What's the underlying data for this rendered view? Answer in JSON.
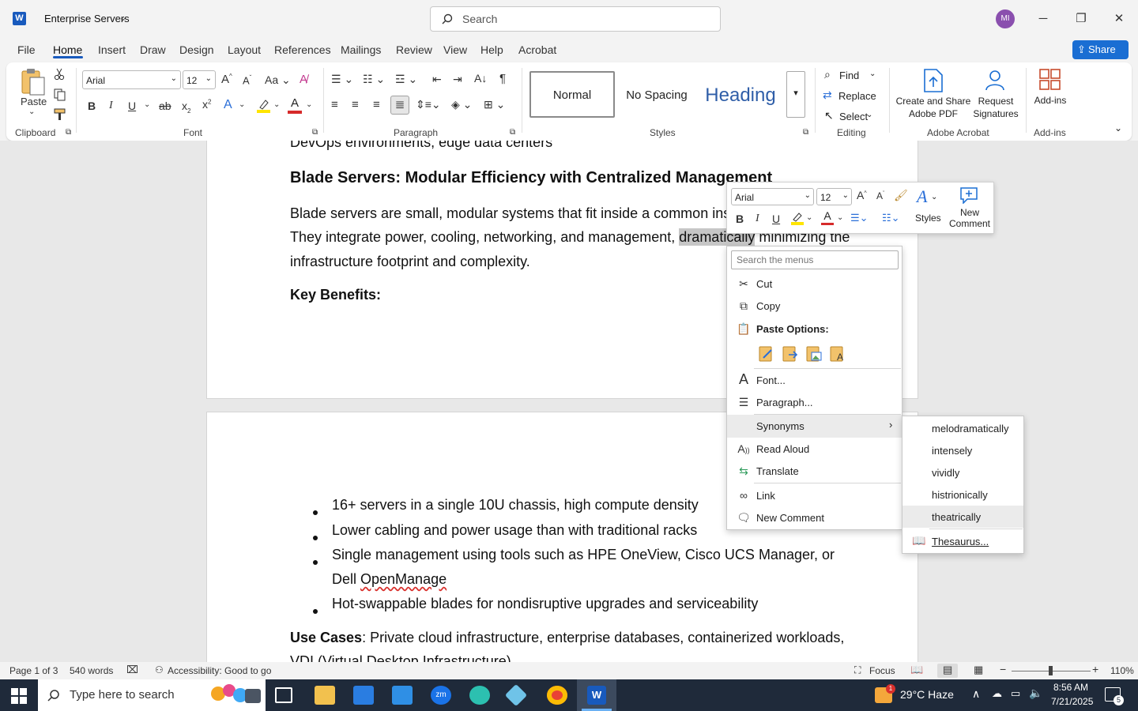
{
  "titlebar": {
    "app_logo": "W",
    "doc_title": "Enterprise Servers",
    "search_placeholder": "Search",
    "avatar_initials": "MI"
  },
  "tabs": [
    "File",
    "Home",
    "Insert",
    "Draw",
    "Design",
    "Layout",
    "References",
    "Mailings",
    "Review",
    "View",
    "Help",
    "Acrobat"
  ],
  "share_label": "Share",
  "ribbon": {
    "clipboard": {
      "paste_label": "Paste",
      "group_label": "Clipboard"
    },
    "font": {
      "font_name": "Arial",
      "font_size": "12",
      "case_label": "Aa",
      "group_label": "Font"
    },
    "paragraph": {
      "group_label": "Paragraph"
    },
    "styles": {
      "items": [
        "Normal",
        "No Spacing",
        "Heading"
      ],
      "group_label": "Styles"
    },
    "editing": {
      "find": "Find",
      "replace": "Replace",
      "select": "Select",
      "group_label": "Editing"
    },
    "adobe": {
      "create_share": [
        "Create and Share",
        "Adobe PDF"
      ],
      "request_sig": [
        "Request",
        "Signatures"
      ],
      "group_label": "Adobe Acrobat"
    },
    "addins": {
      "label": "Add-ins",
      "group_label": "Add-ins"
    }
  },
  "document": {
    "page1": {
      "cut_line": "DevOps environments, edge data centers",
      "heading": "Blade Servers: Modular Efficiency with Centralized Management",
      "para_line1": "Blade servers are small, modular systems that fit inside a common ins",
      "para_line2_before": "They integrate power, cooling, networking, and management, ",
      "para_line2_selected": "dramatically",
      "para_line2_after": " minimizing the",
      "para_line3": "infrastructure footprint and complexity.",
      "key_benefits": "Key Benefits:"
    },
    "page2": {
      "bullets": [
        "16+ servers in a single 10U chassis, high compute density",
        "Lower cabling and power usage than with traditional racks",
        "Single management using tools such as HPE OneView, Cisco UCS Manager, or",
        "Hot-swappable blades for nondisruptive upgrades and serviceability"
      ],
      "bullet3_cont_prefix": "Dell ",
      "bullet3_cont_word": "OpenManage",
      "use_cases_label": "Use Cases",
      "use_cases_text": ": Private cloud infrastructure, enterprise databases, containerized workloads,",
      "use_cases_line2": "VDI (Virtual Desktop Infrastructure)"
    }
  },
  "mini_toolbar": {
    "font_name": "Arial",
    "font_size": "12",
    "styles_label": "Styles",
    "new_comment": [
      "New",
      "Comment"
    ]
  },
  "context_menu": {
    "search_placeholder": "Search the menus",
    "items": {
      "cut": "Cut",
      "copy": "Copy",
      "paste_options": "Paste Options:",
      "font": "Font...",
      "paragraph": "Paragraph...",
      "synonyms": "Synonyms",
      "read_aloud": "Read Aloud",
      "translate": "Translate",
      "link": "Link",
      "new_comment": "New Comment"
    }
  },
  "synonyms_submenu": {
    "items": [
      "melodramatically",
      "intensely",
      "vividly",
      "histrionically",
      "theatrically"
    ],
    "thesaurus": "Thesaurus..."
  },
  "statusbar": {
    "page": "Page 1 of 3",
    "words": "540 words",
    "accessibility": "Accessibility: Good to go",
    "focus": "Focus",
    "zoom": "110%"
  },
  "taskbar": {
    "search_placeholder": "Type here to search",
    "weather": "29°C  Haze",
    "weather_badge": "1",
    "time": "8:56 AM",
    "date": "7/21/2025",
    "notif_count": "5"
  },
  "colors": {
    "accent": "#185abd",
    "share_bg": "#1a6ed3",
    "selection": "#c6c6c6",
    "highlight_yellow": "#ffe500",
    "font_red": "#d62a2a",
    "taskbar": "#1f2a3a"
  }
}
